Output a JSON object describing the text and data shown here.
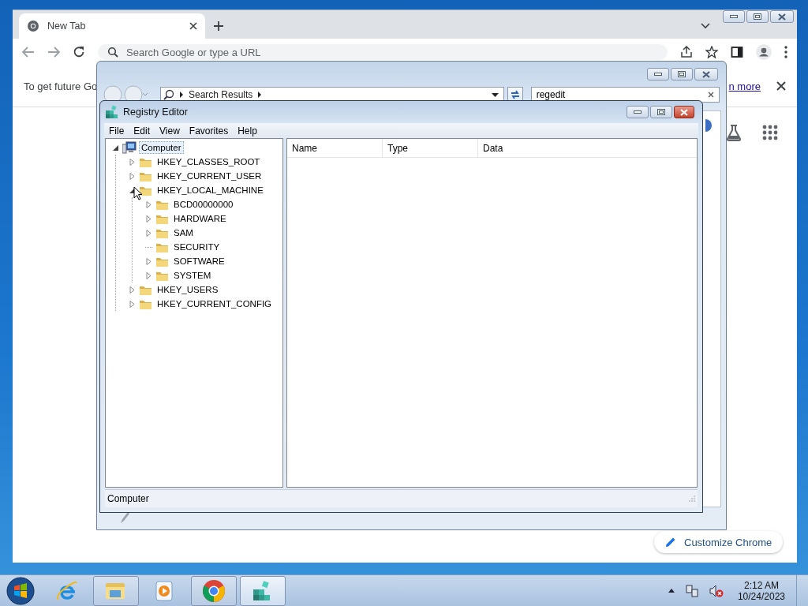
{
  "chrome": {
    "tabs": [
      {
        "label": "New Tab",
        "selected": true
      }
    ],
    "omnibox": {
      "placeholder": "Search Google or type a URL"
    },
    "infobar": {
      "message": "To get future Go",
      "link": "n more"
    },
    "customize_button": "Customize Chrome"
  },
  "explorer": {
    "breadcrumb": "Search Results",
    "search": {
      "value": "regedit"
    }
  },
  "regedit": {
    "title": "Registry Editor",
    "menu": [
      "File",
      "Edit",
      "View",
      "Favorites",
      "Help"
    ],
    "tree": [
      {
        "label": "Computer",
        "kind": "computer",
        "expandable": true,
        "expanded": true,
        "selected": true,
        "children": [
          {
            "label": "HKEY_CLASSES_ROOT",
            "kind": "folder",
            "expandable": true,
            "expanded": false,
            "selected": false
          },
          {
            "label": "HKEY_CURRENT_USER",
            "kind": "folder",
            "expandable": true,
            "expanded": false,
            "selected": false
          },
          {
            "label": "HKEY_LOCAL_MACHINE",
            "kind": "folder",
            "expandable": true,
            "expanded": true,
            "selected": false,
            "children": [
              {
                "label": "BCD00000000",
                "kind": "folder",
                "expandable": true,
                "expanded": false,
                "selected": false
              },
              {
                "label": "HARDWARE",
                "kind": "folder",
                "expandable": true,
                "expanded": false,
                "selected": false
              },
              {
                "label": "SAM",
                "kind": "folder",
                "expandable": true,
                "expanded": false,
                "selected": false
              },
              {
                "label": "SECURITY",
                "kind": "folder",
                "expandable": false,
                "selected": false
              },
              {
                "label": "SOFTWARE",
                "kind": "folder",
                "expandable": true,
                "expanded": false,
                "selected": false
              },
              {
                "label": "SYSTEM",
                "kind": "folder",
                "expandable": true,
                "expanded": false,
                "selected": false
              }
            ]
          },
          {
            "label": "HKEY_USERS",
            "kind": "folder",
            "expandable": true,
            "expanded": false,
            "selected": false
          },
          {
            "label": "HKEY_CURRENT_CONFIG",
            "kind": "folder",
            "expandable": true,
            "expanded": false,
            "selected": false
          }
        ]
      }
    ],
    "columns": [
      "Name",
      "Type",
      "Data"
    ],
    "status_bar": "Computer"
  },
  "taskbar": {
    "items": [
      {
        "kind": "ie",
        "running": false,
        "selected": false
      },
      {
        "kind": "explorer",
        "running": true,
        "selected": false
      },
      {
        "kind": "media",
        "running": false,
        "selected": false
      },
      {
        "kind": "chrome",
        "running": true,
        "selected": false
      },
      {
        "kind": "regedit",
        "running": true,
        "selected": true
      }
    ],
    "clock": {
      "time": "2:12 AM",
      "date": "10/24/2023"
    }
  }
}
